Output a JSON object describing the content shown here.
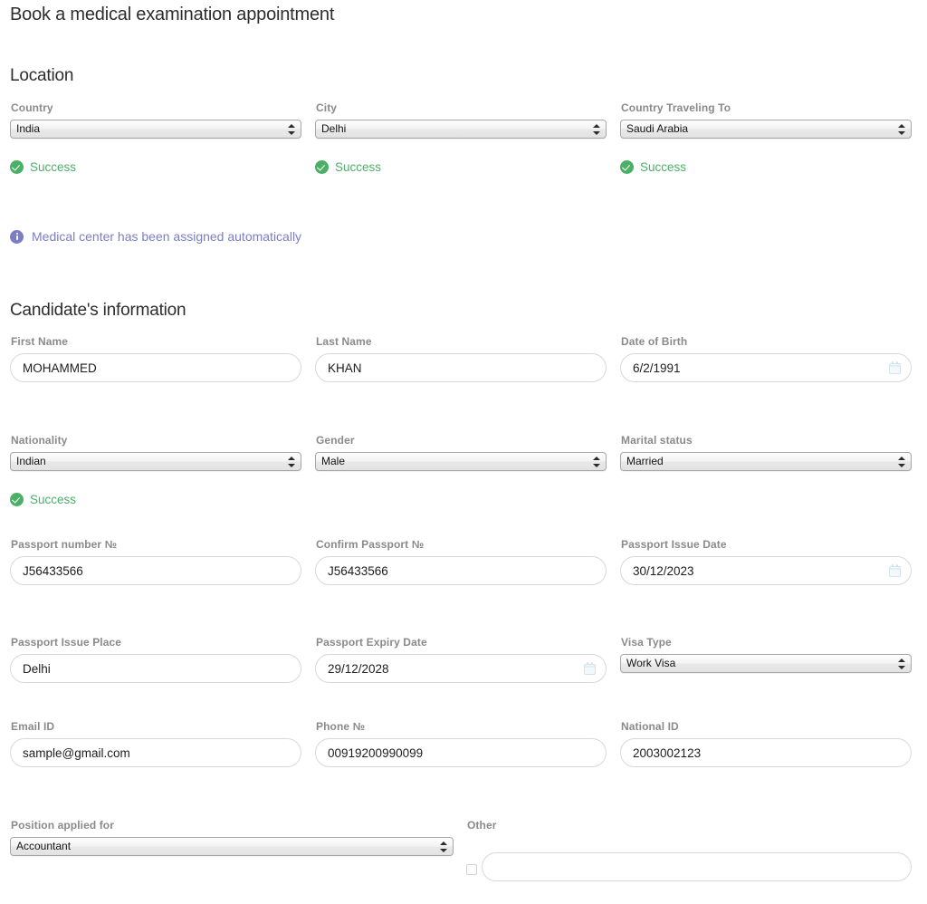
{
  "page": {
    "title": "Book a medical examination appointment"
  },
  "sections": {
    "location": {
      "title": "Location",
      "fields": [
        {
          "label": "Country",
          "value": "India",
          "status": "Success"
        },
        {
          "label": "City",
          "value": "Delhi",
          "status": "Success"
        },
        {
          "label": "Country Traveling To",
          "value": "Saudi Arabia",
          "status": "Success"
        }
      ],
      "info_message": "Medical center has been assigned automatically"
    },
    "candidate": {
      "title": "Candidate's information",
      "first_name": {
        "label": "First Name",
        "value": "MOHAMMED",
        "placeholder": ""
      },
      "last_name": {
        "label": "Last Name",
        "value": "KHAN",
        "placeholder": ""
      },
      "date_of_birth": {
        "label": "Date of Birth",
        "value": "6/2/1991",
        "placeholder": ""
      },
      "nationality": {
        "label": "Nationality",
        "value": "Indian",
        "status": "Success"
      },
      "gender": {
        "label": "Gender",
        "value": "Male"
      },
      "marital_status": {
        "label": "Marital status",
        "value": "Married"
      },
      "passport_number": {
        "label": "Passport number №",
        "value": "J56433566",
        "placeholder": ""
      },
      "confirm_passport": {
        "label": "Confirm Passport №",
        "value": "J56433566",
        "placeholder": ""
      },
      "passport_issue_date": {
        "label": "Passport Issue Date",
        "value": "30/12/2023",
        "placeholder": ""
      },
      "passport_issue_place": {
        "label": "Passport Issue Place",
        "value": "Delhi",
        "placeholder": ""
      },
      "passport_expiry_date": {
        "label": "Passport Expiry Date",
        "value": "29/12/2028",
        "placeholder": ""
      },
      "visa_type": {
        "label": "Visa Type",
        "value": "Work Visa"
      },
      "email": {
        "label": "Email ID",
        "value": "sample@gmail.com",
        "placeholder": ""
      },
      "phone": {
        "label": "Phone №",
        "value": "00919200990099",
        "placeholder": ""
      },
      "national_id": {
        "label": "National ID",
        "value": "2003002123",
        "placeholder": ""
      },
      "position": {
        "label": "Position applied for",
        "value": "Accountant"
      },
      "other": {
        "label": "Other",
        "value": "",
        "placeholder": ""
      }
    }
  },
  "colors": {
    "success": "#4caf68",
    "info": "#7b7ec4",
    "label": "#8a8a8a",
    "text": "#2d2d2d",
    "background": "#ffffff"
  }
}
